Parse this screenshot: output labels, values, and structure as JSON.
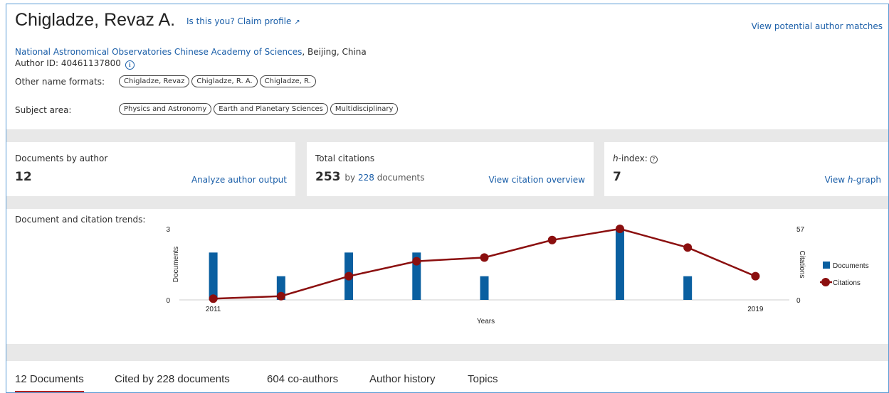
{
  "author": {
    "name": "Chigladze, Revaz A.",
    "claim_label": "Is this you? Claim profile",
    "claim_icon": "external-arrow",
    "view_matches_label": "View potential author matches",
    "affiliation": "National Astronomical Observatories Chinese Academy of Sciences",
    "location": ", Beijing, China",
    "author_id_label": "Author ID: 40461137800",
    "other_names_label": "Other name formats:",
    "other_names": [
      "Chigladze, Revaz",
      "Chigladze, R. A.",
      "Chigladze, R."
    ],
    "subject_label": "Subject area:",
    "subjects": [
      "Physics and Astronomy",
      "Earth and Planetary Sciences",
      "Multidisciplinary"
    ]
  },
  "metrics": {
    "documents": {
      "label": "Documents by author",
      "value": "12",
      "link": "Analyze author output"
    },
    "citations": {
      "label": "Total citations",
      "value": "253",
      "by_text": "by",
      "by_num": "228",
      "by_suffix": "documents",
      "link": "View citation overview"
    },
    "hindex": {
      "label_italic": "h",
      "label_rest": "-index:",
      "value": "7",
      "link_prefix": "View ",
      "link_italic": "h",
      "link_suffix": "-graph"
    }
  },
  "trends": {
    "label": "Document and citation trends:"
  },
  "chart_data": {
    "type": "bar",
    "x": [
      2011,
      2012,
      2013,
      2014,
      2015,
      2016,
      2017,
      2018,
      2019
    ],
    "x_tick_labels": [
      "2011",
      "2019"
    ],
    "xlabel": "Years",
    "ylabel_left": "Documents",
    "ylabel_right": "Citations",
    "ylim_left": [
      0,
      3
    ],
    "ylim_right": [
      0,
      57
    ],
    "series": [
      {
        "name": "Documents",
        "kind": "bar",
        "axis": "left",
        "color": "#0a5fa0",
        "values": [
          2,
          1,
          2,
          2,
          1,
          0,
          3,
          1,
          0
        ]
      },
      {
        "name": "Citations",
        "kind": "line",
        "axis": "right",
        "color": "#8b0f0f",
        "values": [
          1,
          3,
          19,
          31,
          34,
          48,
          57,
          42,
          19
        ]
      }
    ],
    "legend_position": "right"
  },
  "tabs": [
    {
      "label": "12 Documents",
      "active": true
    },
    {
      "label": "Cited by 228 documents",
      "active": false
    },
    {
      "label": "604 co-authors",
      "active": false
    },
    {
      "label": "Author history",
      "active": false
    },
    {
      "label": "Topics",
      "active": false
    }
  ]
}
